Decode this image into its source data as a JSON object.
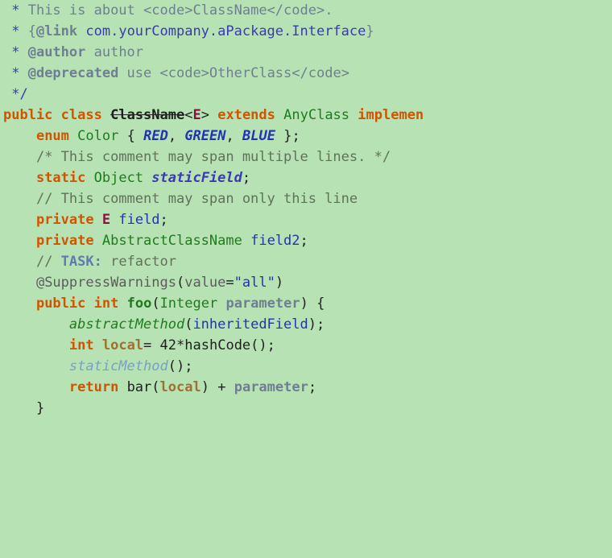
{
  "javadoc": {
    "star": " * ",
    "star2": " *",
    "line1_pre": "This is about ",
    "code_open": "<code>",
    "code_close": "</code>",
    "className": "ClassName",
    "line1_post": ".",
    "link_brace_open": "{",
    "link_tag": "@link",
    "link_target": " com.yourCompany.aPackage.Interface",
    "link_brace_close": "}",
    "author_tag": "@author",
    "author_val": " author",
    "deprecated_tag": "@deprecated",
    "deprecated_pre": " use ",
    "otherClass": "OtherClass",
    "end": "/"
  },
  "decl": {
    "public": "public",
    "class": "class",
    "className": "ClassName",
    "lt": "<",
    "E": "E",
    "gt": ">",
    "extends": "extends",
    "anyClass": "AnyClass",
    "implements": "implemen"
  },
  "enum": {
    "kw": "enum",
    "name": "Color",
    "brace_open": "{",
    "RED": "RED",
    "GREEN": "GREEN",
    "BLUE": "BLUE",
    "comma": ",",
    "brace_close": "}",
    "semi": ";"
  },
  "block_comment": "/* This comment may span multiple lines. */",
  "static_decl": {
    "static": "static",
    "type": "Object",
    "name": "staticField",
    "semi": ";"
  },
  "line_comment": "// This comment may span only this line",
  "field1": {
    "private": "private",
    "E": "E",
    "name": "field",
    "semi": ";"
  },
  "field2": {
    "private": "private",
    "type": "AbstractClassName",
    "name": "field2",
    "semi": ";"
  },
  "task": {
    "prefix": "// ",
    "tag": "TASK:",
    "rest": " refactor"
  },
  "annot": {
    "at": "@SuppressWarnings",
    "open": "(",
    "key": "value",
    "eq": "=",
    "val": "\"all\"",
    "close": ")"
  },
  "method": {
    "public": "public",
    "int": "int",
    "name": "foo",
    "open": "(",
    "ptype": "Integer",
    "pname": "parameter",
    "close": ")",
    "brace_open": "{",
    "brace_close": "}"
  },
  "body": {
    "l1": {
      "call": "abstractMethod",
      "open": "(",
      "arg": "inheritedField",
      "close": ")",
      "semi": ";"
    },
    "l2": {
      "int": "int",
      "local": "local",
      "eq": "=",
      "num": "42",
      "star": "*",
      "hashCode": "hashCode",
      "parens": "()",
      "semi": ";"
    },
    "l3": {
      "call": "staticMethod",
      "parens": "()",
      "semi": ";"
    },
    "l4": {
      "return": "return",
      "bar": "bar",
      "open": "(",
      "local": "local",
      "close": ")",
      "plus": "+",
      "param": "parameter",
      "semi": ";"
    }
  }
}
